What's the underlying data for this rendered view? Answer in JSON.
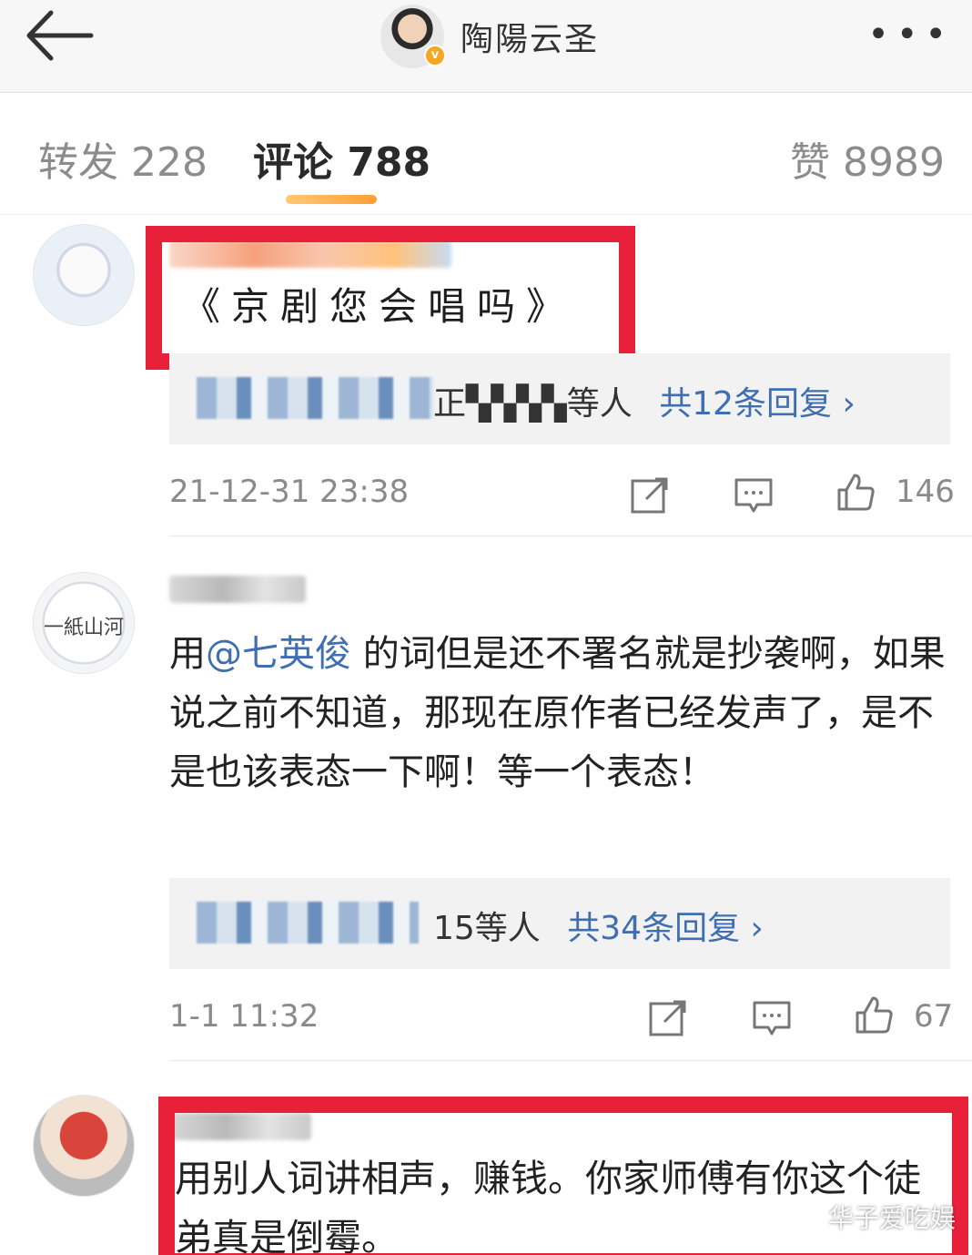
{
  "header": {
    "back_icon": "arrow-left-icon",
    "user_name": "陶陽云圣",
    "verified_badge": "v",
    "more_icon": "more-dots-icon",
    "more_glyph": "•••"
  },
  "tabs": [
    {
      "label": "转发 228"
    },
    {
      "label": "评论 788"
    },
    {
      "label": "赞 8989"
    }
  ],
  "comments": [
    {
      "text": "《京剧您会唱吗》",
      "reply": {
        "users": "正▚▚▚▚等人",
        "link": "共12条回复 ›"
      },
      "time": "21-12-31 23:38",
      "likes": "146"
    },
    {
      "avatar_text": "一紙山河",
      "text_before": "用",
      "mention": "@七英俊",
      "text_after": " 的词但是还不署名就是抄袭啊，如果说之前不知道，那现在原作者已经发声了，是不是也该表态一下啊！等一个表态！",
      "reply": {
        "users": "15等人",
        "link": "共34条回复 ›"
      },
      "time": "1-1 11:32",
      "likes": "67"
    },
    {
      "text": "用别人词讲相声，赚钱。你家师傅有你这个徒弟真是倒霉。"
    }
  ],
  "watermark": "华子爱吃娱",
  "colors": {
    "highlight": "#e8203a",
    "link": "#3f6fb0",
    "tab_underline": "#ff9f36"
  }
}
